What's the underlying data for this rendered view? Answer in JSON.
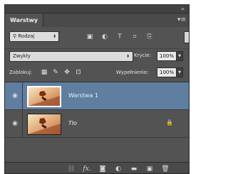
{
  "panel": {
    "collapse_glyph": "«",
    "tab_label": "Warstwy",
    "menu_icon": "panel-menu-icon"
  },
  "filter": {
    "kind_label": "Rodzaj",
    "icons": [
      "pixel-filter-icon",
      "adjustment-filter-icon",
      "type-filter-icon",
      "shape-filter-icon",
      "smart-object-filter-icon"
    ]
  },
  "blend": {
    "mode": "Zwykły",
    "opacity_label": "Krycie:",
    "opacity_value": "100%"
  },
  "lock": {
    "label": "Zablokuj:",
    "icons": [
      "lock-transparency-icon",
      "lock-pixels-icon",
      "lock-position-icon",
      "lock-all-icon"
    ],
    "fill_label": "Wypełnienie:",
    "fill_value": "100%"
  },
  "layers": [
    {
      "name": "Warstwa 1",
      "visible": true,
      "selected": true,
      "locked": false
    },
    {
      "name": "Tło",
      "visible": true,
      "selected": false,
      "locked": true
    }
  ],
  "bottom_bar": {
    "icons": [
      "link-layers-icon",
      "fx-icon",
      "add-mask-icon",
      "new-adjustment-icon",
      "new-group-icon",
      "new-layer-icon",
      "delete-icon"
    ],
    "fx_text": "fx."
  },
  "colors": {
    "panel_bg": "#535353",
    "selected_layer": "#5f7ea0"
  }
}
